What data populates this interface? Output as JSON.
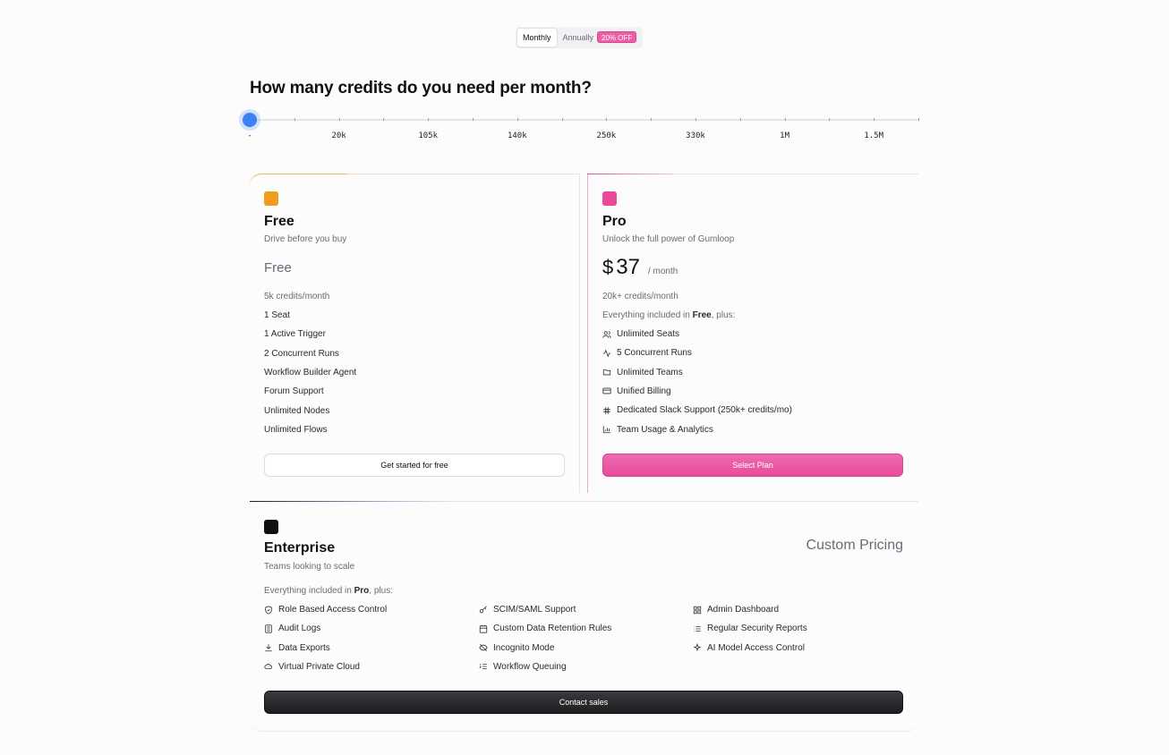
{
  "billing": {
    "monthly_label": "Monthly",
    "annually_label": "Annually",
    "discount_badge": "20% OFF",
    "selected": "Monthly"
  },
  "question": "How many credits do you need per month?",
  "slider": {
    "value_index": 0,
    "tick_count": 16,
    "labels": [
      "-",
      "20k",
      "105k",
      "140k",
      "250k",
      "330k",
      "1M",
      "1.5M"
    ],
    "accent_color": "#3b82f6"
  },
  "plans": {
    "free": {
      "name": "Free",
      "description": "Drive before you buy",
      "price": "Free",
      "credits": "5k credits/month",
      "features": [
        "1 Seat",
        "1 Active Trigger",
        "2 Concurrent Runs",
        "Workflow Builder Agent",
        "Forum Support",
        "Unlimited Nodes",
        "Unlimited Flows"
      ],
      "button": "Get started for free",
      "color": "#f09d1e"
    },
    "pro": {
      "name": "Pro",
      "description": "Unlock the full power of Gumloop",
      "currency": "$",
      "amount": "37",
      "period": "/ month",
      "credits": "20k+ credits/month",
      "includes_prefix": "Everything included in ",
      "includes_plan": "Free",
      "includes_suffix": ", plus:",
      "features": [
        {
          "icon": "users-icon",
          "label": "Unlimited Seats"
        },
        {
          "icon": "activity-icon",
          "label": "5 Concurrent Runs"
        },
        {
          "icon": "folder-icon",
          "label": "Unlimited Teams"
        },
        {
          "icon": "credit-card-icon",
          "label": "Unified Billing"
        },
        {
          "icon": "slack-icon",
          "label": "Dedicated Slack Support (250k+ credits/mo)"
        },
        {
          "icon": "bar-chart-icon",
          "label": "Team Usage & Analytics"
        }
      ],
      "button": "Select Plan",
      "color": "#ec4899"
    },
    "enterprise": {
      "name": "Enterprise",
      "description": "Teams looking to scale",
      "price": "Custom Pricing",
      "includes_prefix": "Everything included in ",
      "includes_plan": "Pro",
      "includes_suffix": ", plus:",
      "features": [
        {
          "icon": "shield-icon",
          "label": "Role Based Access Control"
        },
        {
          "icon": "key-icon",
          "label": "SCIM/SAML Support"
        },
        {
          "icon": "dashboard-icon",
          "label": "Admin Dashboard"
        },
        {
          "icon": "file-icon",
          "label": "Audit Logs"
        },
        {
          "icon": "calendar-icon",
          "label": "Custom Data Retention Rules"
        },
        {
          "icon": "list-icon",
          "label": "Regular Security Reports"
        },
        {
          "icon": "download-icon",
          "label": "Data Exports"
        },
        {
          "icon": "eye-off-icon",
          "label": "Incognito Mode"
        },
        {
          "icon": "sparkles-icon",
          "label": "AI Model Access Control"
        },
        {
          "icon": "cloud-icon",
          "label": "Virtual Private Cloud"
        },
        {
          "icon": "list-ordered-icon",
          "label": "Workflow Queuing"
        }
      ],
      "button": "Contact sales",
      "color": "#0f0f14"
    }
  }
}
